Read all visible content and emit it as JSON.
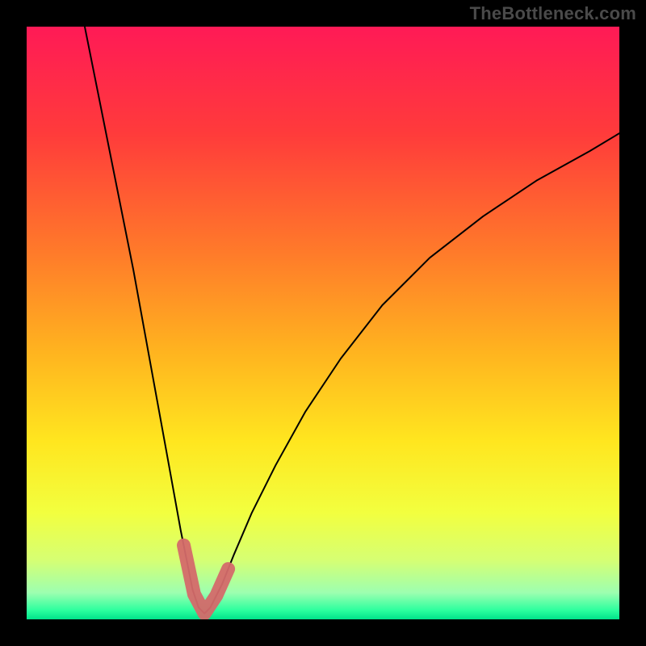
{
  "watermark": "TheBottleneck.com",
  "colors": {
    "frame": "#000000",
    "curve": "#000000",
    "flat_band": "#d46a6a"
  },
  "gradient_stops": [
    {
      "offset": 0.0,
      "color": "#ff1a56"
    },
    {
      "offset": 0.18,
      "color": "#ff3b3b"
    },
    {
      "offset": 0.38,
      "color": "#ff7a2a"
    },
    {
      "offset": 0.55,
      "color": "#ffb41f"
    },
    {
      "offset": 0.7,
      "color": "#ffe61f"
    },
    {
      "offset": 0.82,
      "color": "#f2ff3f"
    },
    {
      "offset": 0.9,
      "color": "#d6ff73"
    },
    {
      "offset": 0.955,
      "color": "#9dffb0"
    },
    {
      "offset": 0.985,
      "color": "#2bff9e"
    },
    {
      "offset": 1.0,
      "color": "#00e38a"
    }
  ],
  "chart_data": {
    "type": "line",
    "title": "",
    "xlabel": "",
    "ylabel": "",
    "xlim": [
      0,
      100
    ],
    "ylim": [
      0,
      100
    ],
    "description": "Bottleneck-percentage style curve. x is a normalized hardware-balance axis (0–100). y is bottleneck % (0 at bottom = no bottleneck, 100 at top = full bottleneck). Minimum (optimum) sits near x ≈ 28–32. Left branch is much steeper than the right branch. A thick salmon overlay marks the near-zero region around the trough.",
    "min_x": 30,
    "series": [
      {
        "name": "bottleneck_pct",
        "x": [
          0,
          4,
          8,
          12,
          15,
          18,
          20,
          22,
          24,
          26,
          27,
          28,
          29,
          30,
          31,
          32,
          33,
          35,
          38,
          42,
          47,
          53,
          60,
          68,
          77,
          86,
          95,
          100
        ],
        "y": [
          150,
          130,
          109,
          89,
          74,
          59,
          48,
          37,
          26,
          15,
          10,
          5,
          2,
          1,
          2,
          4,
          6,
          11,
          18,
          26,
          35,
          44,
          53,
          61,
          68,
          74,
          79,
          82
        ]
      }
    ],
    "flat_band": {
      "x_from": 26.5,
      "x_to": 34.0,
      "y_from": 10,
      "y_to": 10
    }
  }
}
